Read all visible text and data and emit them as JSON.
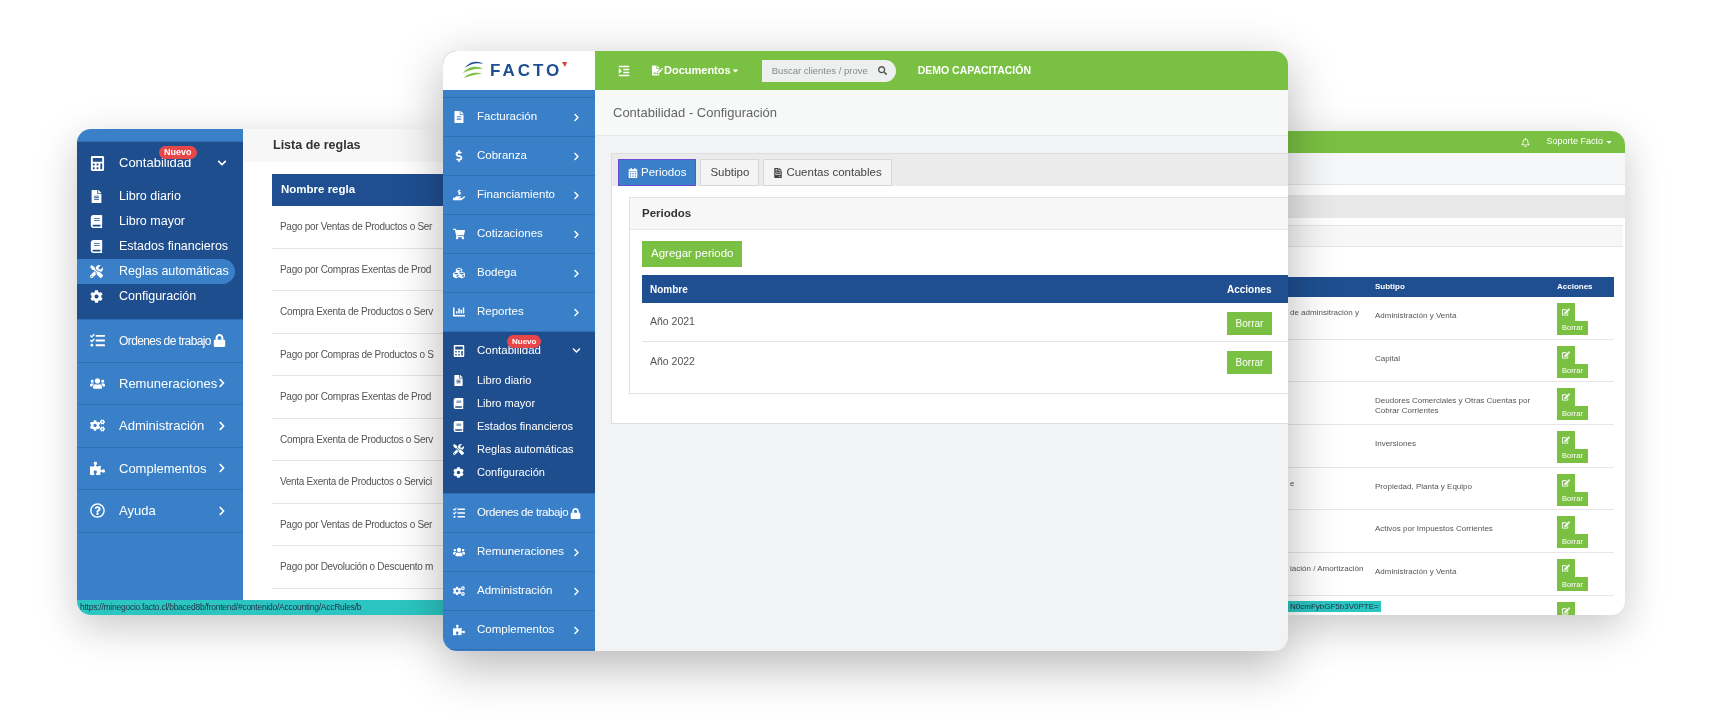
{
  "left_window": {
    "sidebar": [
      {
        "kind": "group",
        "label": "Contabilidad",
        "badge": "Nuevo",
        "expanded": true,
        "children": [
          {
            "label": "Libro diario",
            "selected": false
          },
          {
            "label": "Libro mayor",
            "selected": false
          },
          {
            "label": "Estados financieros",
            "selected": false
          },
          {
            "label": "Reglas automáticas",
            "selected": true
          },
          {
            "label": "Configuración",
            "selected": false
          }
        ]
      },
      {
        "kind": "item",
        "label": "Ordenes de trabajo",
        "locked": true
      },
      {
        "kind": "item",
        "label": "Remuneraciones",
        "locked": false
      },
      {
        "kind": "item",
        "label": "Administración",
        "locked": false
      },
      {
        "kind": "item",
        "label": "Complementos",
        "locked": false
      },
      {
        "kind": "item",
        "label": "Ayuda",
        "locked": false
      }
    ],
    "title": "Lista de reglas",
    "table": {
      "columns": [
        "Nombre regla"
      ],
      "rows": [
        "Pago por Ventas de Productos o Ser",
        "Pago por Compras Exentas de Prod",
        "Compra Exenta de Productos o Serv",
        "Pago por Compras de Productos o S",
        "Pago por Compras Exentas de Prod",
        "Compra Exenta de Productos o Serv",
        "Venta Exenta de Productos o Servici",
        "Pago por Ventas de Productos o Ser",
        "Pago por Devolución o Descuento m"
      ]
    },
    "status_bar": "https://minegocio.facto.cl/bbaced8b/frontend/#contenido/Accounting/AccRules/b"
  },
  "main_window": {
    "logo": "FACTO",
    "topbar": {
      "menu": "Documentos",
      "search": {
        "placeholder": "Buscar clientes / prove"
      },
      "company": "DEMO CAPACITACIÓN"
    },
    "sidebar": [
      {
        "kind": "item",
        "label": "Facturación",
        "locked": false
      },
      {
        "kind": "item",
        "label": "Cobranza",
        "locked": false
      },
      {
        "kind": "item",
        "label": "Financiamiento",
        "locked": false
      },
      {
        "kind": "item",
        "label": "Cotizaciones",
        "locked": false
      },
      {
        "kind": "item",
        "label": "Bodega",
        "locked": false
      },
      {
        "kind": "item",
        "label": "Reportes",
        "locked": false
      },
      {
        "kind": "group",
        "label": "Contabilidad",
        "badge": "Nuevo",
        "expanded": true,
        "children": [
          {
            "label": "Libro diario",
            "selected": false
          },
          {
            "label": "Libro mayor",
            "selected": false
          },
          {
            "label": "Estados financieros",
            "selected": false
          },
          {
            "label": "Reglas automáticas",
            "selected": false
          },
          {
            "label": "Configuración",
            "selected": false
          }
        ]
      },
      {
        "kind": "item",
        "label": "Ordenes de trabajo",
        "locked": true
      },
      {
        "kind": "item",
        "label": "Remuneraciones",
        "locked": false
      },
      {
        "kind": "item",
        "label": "Administración",
        "locked": false
      },
      {
        "kind": "item",
        "label": "Complementos",
        "locked": false
      }
    ],
    "page_title": "Contabilidad - Configuración",
    "tabs": [
      {
        "label": "Periodos",
        "selected": true
      },
      {
        "label": "Subtipo",
        "selected": false
      },
      {
        "label": "Cuentas contables",
        "selected": false
      }
    ],
    "card": {
      "title": "Periodos",
      "add_button": "Agregar periodo",
      "table": {
        "columns": [
          "Nombre",
          "Acciones"
        ],
        "rows": [
          {
            "name": "Año 2021",
            "action": "Borrar"
          },
          {
            "name": "Año 2022",
            "action": "Borrar"
          }
        ]
      }
    }
  },
  "right_window": {
    "user_menu": "Soporte Facto",
    "table": {
      "columns": [
        "Subtipo",
        "Acciones"
      ],
      "rows": [
        {
          "column_1": "de adminsitración y",
          "subtipo": "Administración y Venta",
          "action": "Borrar"
        },
        {
          "subtipo": "Capital",
          "action": "Borrar"
        },
        {
          "subtipo": "Deudores Comerciales y Otras Cuentas por Cobrar Corrientes",
          "action": "Borrar"
        },
        {
          "subtipo": "Inversiones",
          "action": "Borrar"
        },
        {
          "column_1": "e",
          "subtipo": "Propiedad, Planta y Equipo",
          "action": "Borrar"
        },
        {
          "subtipo": "Activos por Impuestos Corrientes",
          "action": "Borrar"
        },
        {
          "column_1": "iación / Amortización",
          "subtipo": "Administración y Venta",
          "action": "Borrar"
        },
        {}
      ]
    },
    "status_bar": "N0cmFybGF5b3V0PTE="
  }
}
